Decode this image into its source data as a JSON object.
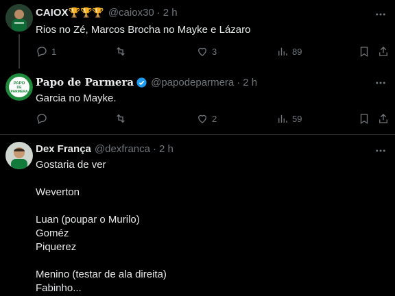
{
  "tweets": [
    {
      "name": "CAIOX",
      "trophies": [
        "🏆",
        "🏆",
        "🏆"
      ],
      "handle": "@caiox30",
      "time": "2 h",
      "text": "Rios no Zé, Marcos Brocha no Mayke e Lázaro",
      "replies": "1",
      "retweets": "",
      "likes": "3",
      "views": "89"
    },
    {
      "name": "Papo de Parmera",
      "handle": "@papodeparmera",
      "time": "2 h",
      "text": "Garcia no Mayke.",
      "avatar_text": "PAPO DE PARMERA",
      "replies": "",
      "retweets": "",
      "likes": "2",
      "views": "59"
    },
    {
      "name": "Dex França",
      "handle": "@dexfranca",
      "time": "2 h",
      "lines": [
        "Gostaria de ver",
        "",
        "Weverton",
        "",
        "Luan (poupar o Murilo)",
        "Goméz",
        "Piquerez",
        "",
        "Menino (testar de ala direita)",
        "Fabinho..."
      ]
    }
  ],
  "colors": {
    "background": "#000000",
    "text": "#e7e9ea",
    "muted": "#71767b",
    "verified": "#1d9bf0",
    "brand_green": "#1e8a3c"
  },
  "icons": [
    "reply-icon",
    "retweet-icon",
    "like-icon",
    "views-icon",
    "bookmark-icon",
    "share-icon",
    "more-icon",
    "verified-icon"
  ]
}
